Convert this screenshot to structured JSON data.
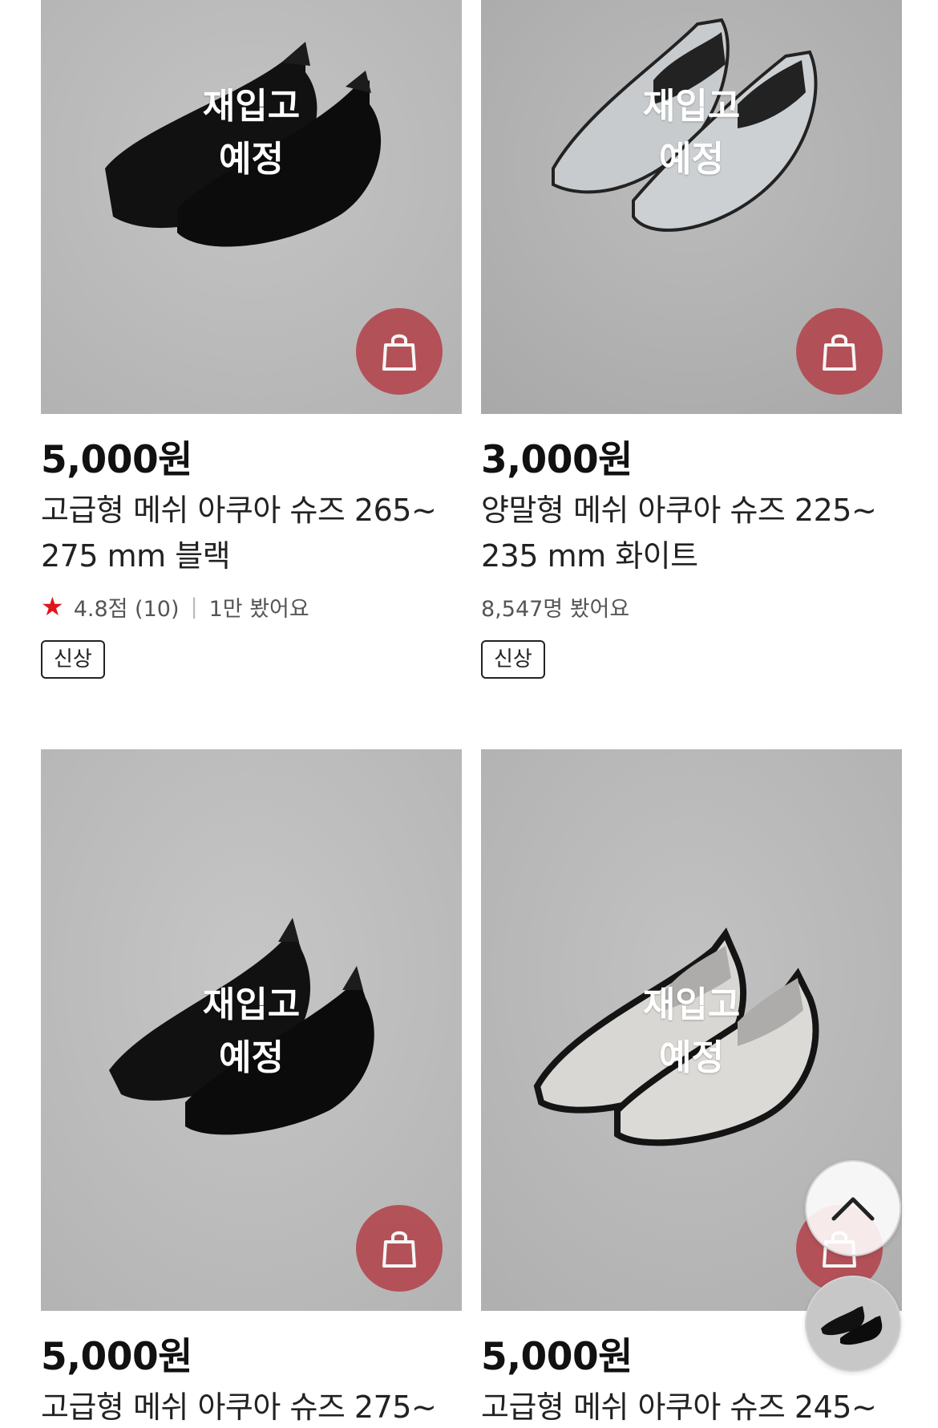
{
  "products": [
    {
      "price": "5,000원",
      "name_line1": "고급형 메쉬 아쿠아 슈즈 265~",
      "name_line2": "275 mm 블랙",
      "rating": "4.8점 (10)",
      "views": "1만 봤어요",
      "tag": "신상",
      "badge_line1": "재입고",
      "badge_line2": "예정",
      "color": "#0f0f0f"
    },
    {
      "price": "3,000원",
      "name_line1": "양말형 메쉬 아쿠아 슈즈 225~",
      "name_line2": "235 mm 화이트",
      "views": "8,547명 봤어요",
      "tag": "신상",
      "badge_line1": "재입고",
      "badge_line2": "예정",
      "color": "#c9ccce"
    },
    {
      "price": "5,000원",
      "name_line1": "고급형 메쉬 아쿠아 슈즈 275~",
      "badge_line1": "재입고",
      "badge_line2": "예정",
      "color": "#0d0d0d"
    },
    {
      "price": "5,000원",
      "name_line1": "고급형 메쉬 아쿠아 슈즈 245~",
      "badge_line1": "재입고",
      "badge_line2": "예정",
      "color": "#d7d5d1"
    }
  ],
  "icons": {
    "cart": "shopping-bag-icon",
    "rating": "star-icon",
    "scroll_top": "chevron-up-icon"
  },
  "colors": {
    "cart_button": "#b3434c",
    "rating_star": "#e0151b",
    "photo_background": "#bdbdbd"
  }
}
